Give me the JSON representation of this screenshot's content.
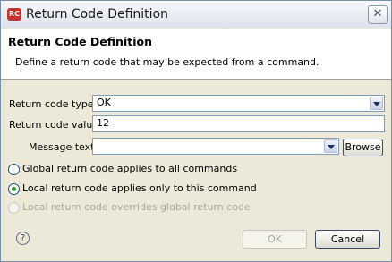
{
  "window": {
    "title": "Return Code Definition",
    "app_icon_text": "RC"
  },
  "header": {
    "title": "Return Code Definition",
    "description": "Define a return code that may be expected from a command."
  },
  "form": {
    "type_label": "Return code type",
    "type_value": "OK",
    "value_label": "Return code value",
    "value_value": "12",
    "message_label": "Message text",
    "message_value": "",
    "browse_label": "Browse"
  },
  "radios": [
    {
      "label": "Global return code applies to all commands",
      "checked": false,
      "enabled": true
    },
    {
      "label": "Local return code applies only to this command",
      "checked": true,
      "enabled": true
    },
    {
      "label": "Local return code overrides global return code",
      "checked": false,
      "enabled": false
    }
  ],
  "footer": {
    "help_glyph": "?",
    "ok_label": "OK",
    "cancel_label": "Cancel"
  }
}
